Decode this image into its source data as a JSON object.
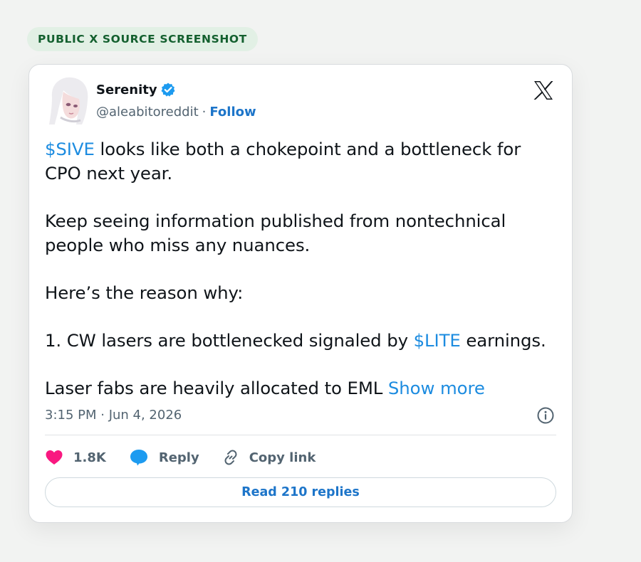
{
  "badge": {
    "label": "PUBLIC X SOURCE SCREENSHOT"
  },
  "tweet": {
    "author": {
      "display_name": "Serenity",
      "handle": "@aleabitoreddit",
      "separator": "·",
      "follow_label": "Follow",
      "verified": true
    },
    "body": {
      "p1_cashtag": "$SIVE",
      "p1_text": " looks like both a chokepoint and a bottleneck for CPO next year.",
      "p2": "Keep seeing information published from nontechnical people who miss any nuances.",
      "p3": "Here’s the reason why:",
      "p4_before": "1. CW lasers are bottlenecked signaled by ",
      "p4_cashtag": "$LITE",
      "p4_after": " earnings.",
      "p5_text": "Laser fabs are heavily allocated to EML ",
      "show_more": "Show more"
    },
    "timestamp": "3:15 PM · Jun 4, 2026",
    "actions": {
      "likes": "1.8K",
      "reply_label": "Reply",
      "copy_link_label": "Copy link"
    },
    "read_replies_label": "Read 210 replies"
  },
  "icons": {
    "verified": "verified-badge-icon",
    "platform": "x-logo-icon",
    "info": "info-icon",
    "like": "heart-icon",
    "reply": "speech-bubble-icon",
    "link": "link-icon"
  },
  "colors": {
    "link_blue": "#1d75c9",
    "cashtag_blue": "#1d8ce0",
    "heart_pink": "#f91880",
    "reply_blue": "#1d9bf0",
    "badge_green": "#14602f",
    "badge_bg": "#e2f0e5"
  }
}
